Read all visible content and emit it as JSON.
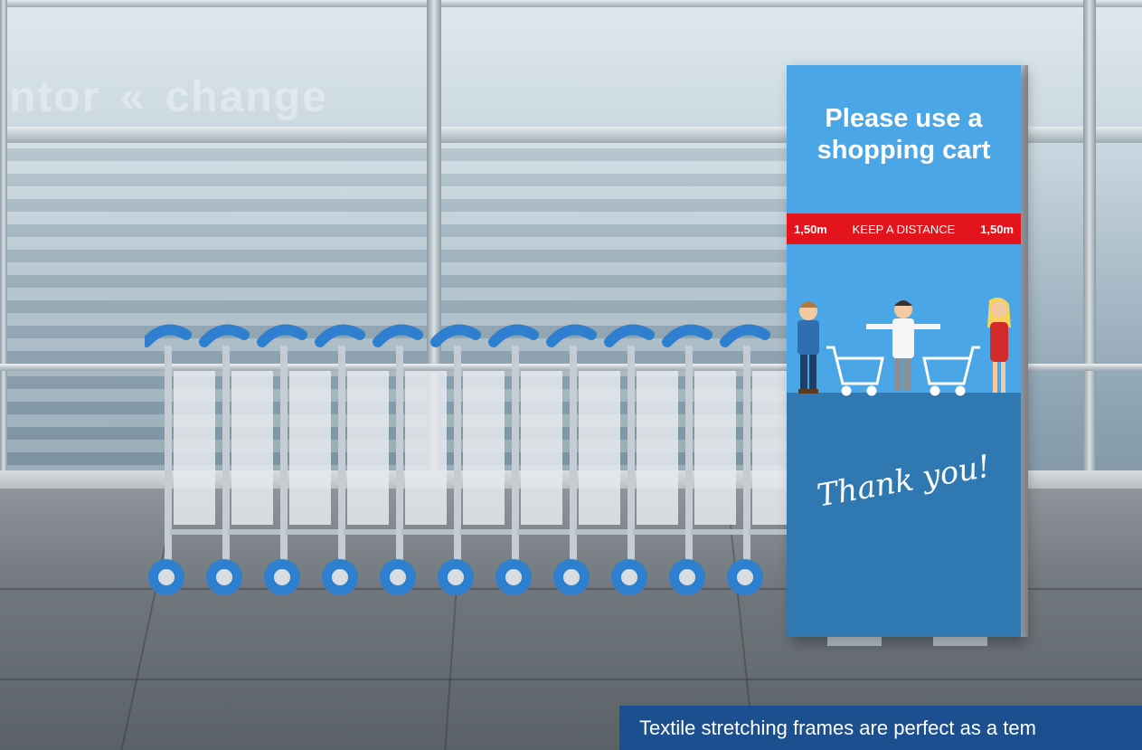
{
  "background_sign": {
    "left_word": "ntor",
    "right_word": "change"
  },
  "poster": {
    "title_line1": "Please use a",
    "title_line2": "shopping cart",
    "band_left": "1,50m",
    "band_center": "KEEP A DISTANCE",
    "band_right": "1,50m",
    "thanks": "Thank you!",
    "colors": {
      "upper": "#4aa6e6",
      "lower": "#2f78b2",
      "band": "#e3141b"
    }
  },
  "caption": {
    "text": "Textile stretching frames are perfect as a tem"
  }
}
